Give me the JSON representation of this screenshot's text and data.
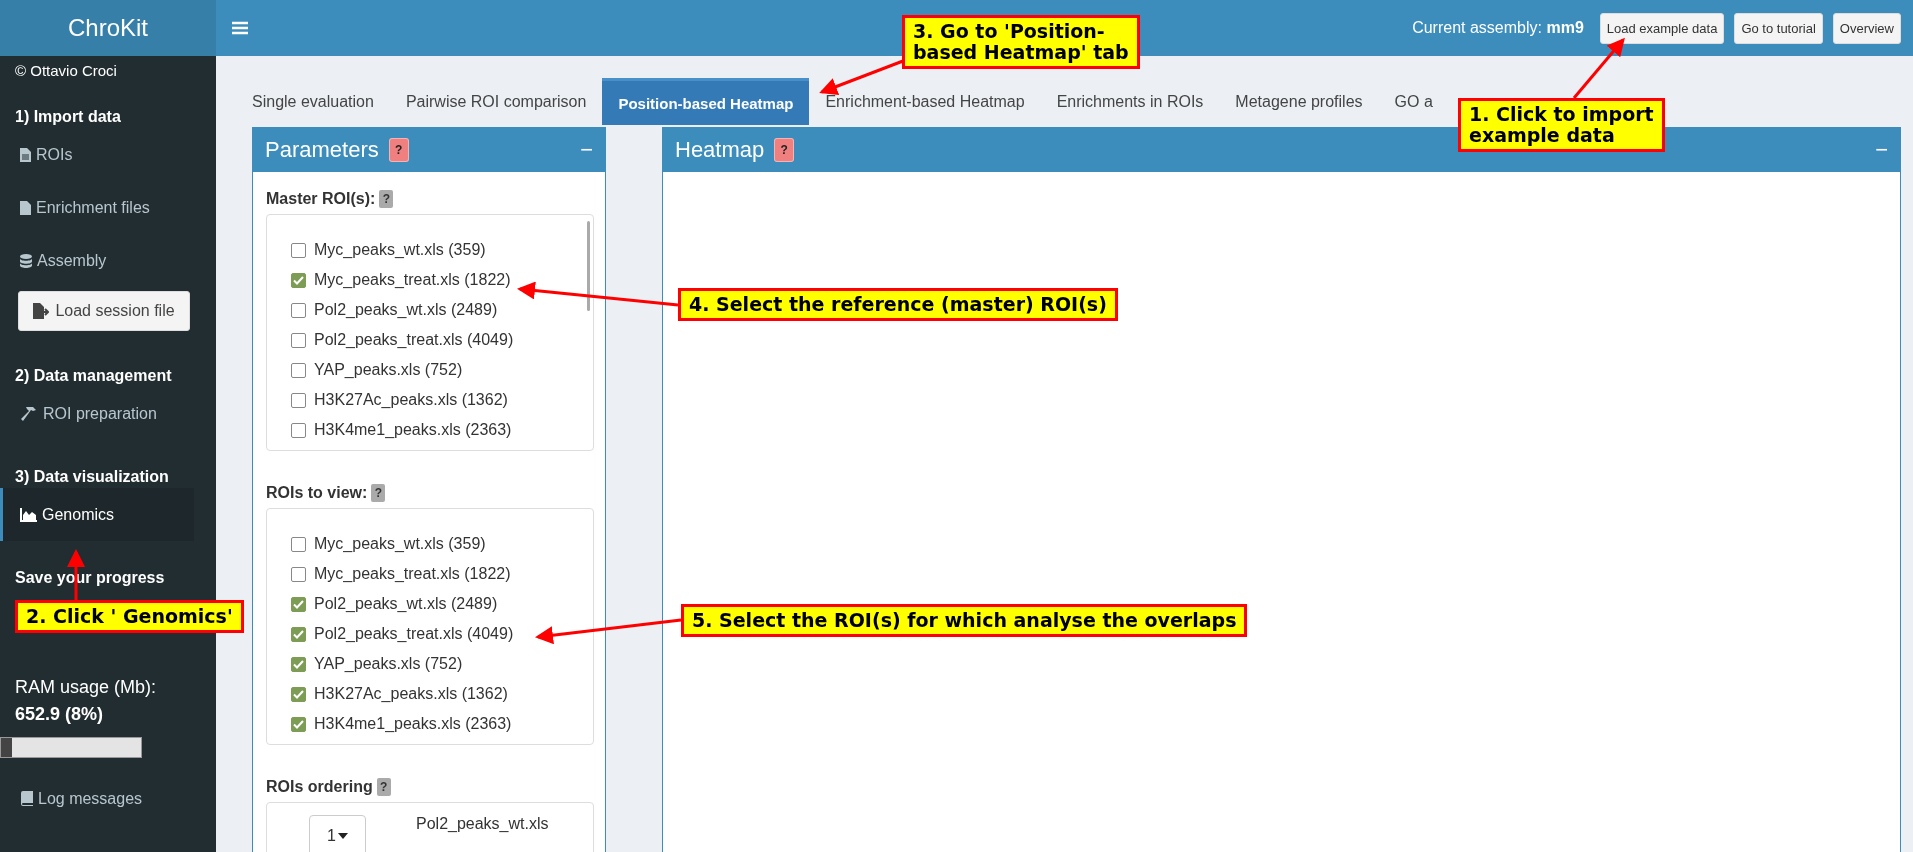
{
  "logo": "ChroKit",
  "header": {
    "assembly_label": "Current assembly:",
    "assembly": "mm9",
    "buttons": [
      "Load example data",
      "Go to tutorial",
      "Overview"
    ]
  },
  "sidebar": {
    "items": [
      {
        "kind": "author",
        "text": "© Ottavio Croci"
      },
      {
        "kind": "heading",
        "text": "1) Import data"
      },
      {
        "kind": "link",
        "label": "ROIs",
        "selected": false
      },
      {
        "kind": "link",
        "label": "Enrichment files",
        "selected": false
      },
      {
        "kind": "link",
        "label": "Assembly",
        "selected": false
      },
      {
        "kind": "button",
        "label": "Load session file"
      },
      {
        "kind": "heading",
        "text": "2) Data management"
      },
      {
        "kind": "link",
        "label": "ROI preparation",
        "selected": false
      },
      {
        "kind": "heading",
        "text": "3) Data visualization"
      },
      {
        "kind": "link",
        "label": "Genomics",
        "selected": true
      },
      {
        "kind": "heading",
        "text": "Save your progress"
      },
      {
        "kind": "ram",
        "label": "RAM usage (Mb):",
        "value": "652.9 (8%)",
        "level": 0.08
      },
      {
        "kind": "link",
        "label": "Log messages",
        "selected": false
      }
    ]
  },
  "tabs": [
    {
      "label": "Single evaluation",
      "selected": false
    },
    {
      "label": "Pairwise ROI comparison",
      "selected": false
    },
    {
      "label": "Position-based Heatmap",
      "selected": true
    },
    {
      "label": "Enrichment-based Heatmap",
      "selected": false
    },
    {
      "label": "Enrichments in ROIs",
      "selected": false
    },
    {
      "label": "Metagene profiles",
      "selected": false
    },
    {
      "label": "GO a",
      "selected": false
    }
  ],
  "parameters": {
    "title": "Parameters",
    "help": "?",
    "collapse": "−",
    "groups": [
      {
        "label": "Master ROI(s):",
        "help": "?",
        "scrollbar": true,
        "options": [
          {
            "label": "Myc_peaks_wt.xls (359)",
            "checked": false
          },
          {
            "label": "Myc_peaks_treat.xls (1822)",
            "checked": true
          },
          {
            "label": "Pol2_peaks_wt.xls (2489)",
            "checked": false
          },
          {
            "label": "Pol2_peaks_treat.xls (4049)",
            "checked": false
          },
          {
            "label": "YAP_peaks.xls (752)",
            "checked": false
          },
          {
            "label": "H3K27Ac_peaks.xls (1362)",
            "checked": false
          },
          {
            "label": "H3K4me1_peaks.xls (2363)",
            "checked": false
          }
        ]
      },
      {
        "label": "ROIs to view:",
        "help": "?",
        "scrollbar": false,
        "options": [
          {
            "label": "Myc_peaks_wt.xls (359)",
            "checked": false
          },
          {
            "label": "Myc_peaks_treat.xls (1822)",
            "checked": false
          },
          {
            "label": "Pol2_peaks_wt.xls (2489)",
            "checked": true
          },
          {
            "label": "Pol2_peaks_treat.xls (4049)",
            "checked": true
          },
          {
            "label": "YAP_peaks.xls (752)",
            "checked": true
          },
          {
            "label": "H3K27Ac_peaks.xls (1362)",
            "checked": true
          },
          {
            "label": "H3K4me1_peaks.xls (2363)",
            "checked": true
          }
        ]
      }
    ],
    "ordering": {
      "label": "ROIs ordering",
      "help": "?",
      "rank": "1",
      "name": "Pol2_peaks_wt.xls"
    }
  },
  "heatmap": {
    "title": "Heatmap",
    "help": "?",
    "collapse": "−"
  },
  "annotations": [
    {
      "lines": [
        "1. Click to import",
        "example data"
      ]
    },
    {
      "lines": [
        "2. Click ' Genomics'"
      ]
    },
    {
      "lines": [
        "3. Go to 'Position-",
        "based Heatmap' tab"
      ]
    },
    {
      "lines": [
        "4. Select the reference (master) ROI(s)"
      ]
    },
    {
      "lines": [
        "5. Select the ROI(s) for which analyse the overlaps"
      ]
    }
  ]
}
